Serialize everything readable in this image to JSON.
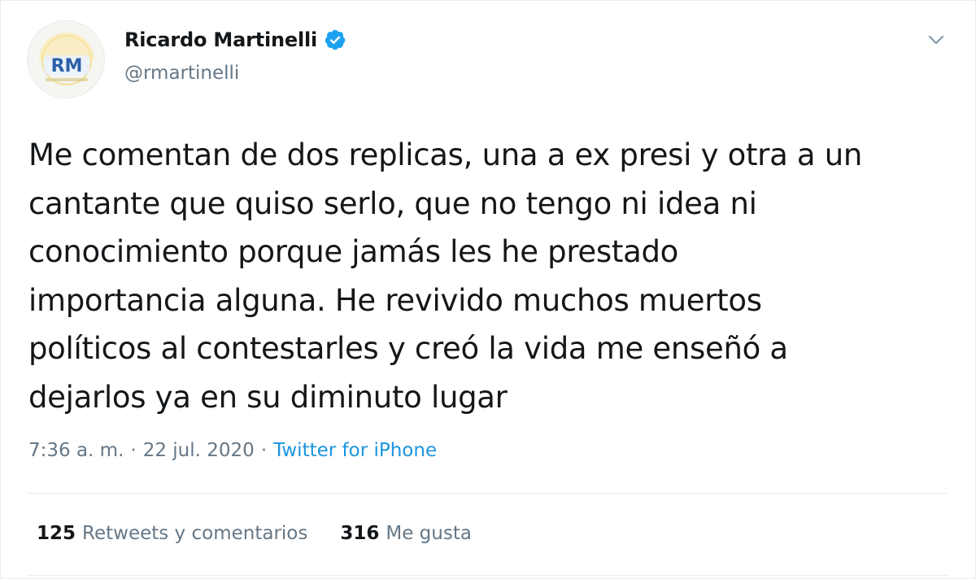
{
  "author": {
    "display_name": "Ricardo Martinelli",
    "handle": "@rmartinelli",
    "verified": true,
    "avatar_icon": "rm-logo-avatar",
    "avatar_initials": "RM"
  },
  "tweet": {
    "text": "Me comentan de dos replicas, una a ex presi y otra a un cantante que quiso serlo, que no tengo ni idea ni conocimiento porque jamás les he prestado importancia alguna. He revivido muchos muertos políticos al contestarles y creó la vida me enseñó a dejarlos ya en su diminuto lugar",
    "lines": [
      "Me comentan de dos replicas, una a ex presi y otra a un",
      "cantante que quiso serlo, que no tengo ni idea ni",
      "conocimiento porque jamás les he prestado",
      "importancia alguna. He revivido muchos muertos",
      "políticos al contestarles y creó la vida me enseñó a",
      "dejarlos ya en su diminuto lugar"
    ],
    "time": "7:36 a. m.",
    "separator": "·",
    "date": "22 jul. 2020",
    "source": "Twitter for iPhone"
  },
  "stats": {
    "retweets_count": "125",
    "retweets_label": "Retweets y comentarios",
    "likes_count": "316",
    "likes_label": "Me gusta"
  },
  "colors": {
    "text_primary": "#14171a",
    "text_secondary": "#657786",
    "link": "#1b95e0",
    "verified": "#1da1f2",
    "divider": "#e6ecf0"
  }
}
